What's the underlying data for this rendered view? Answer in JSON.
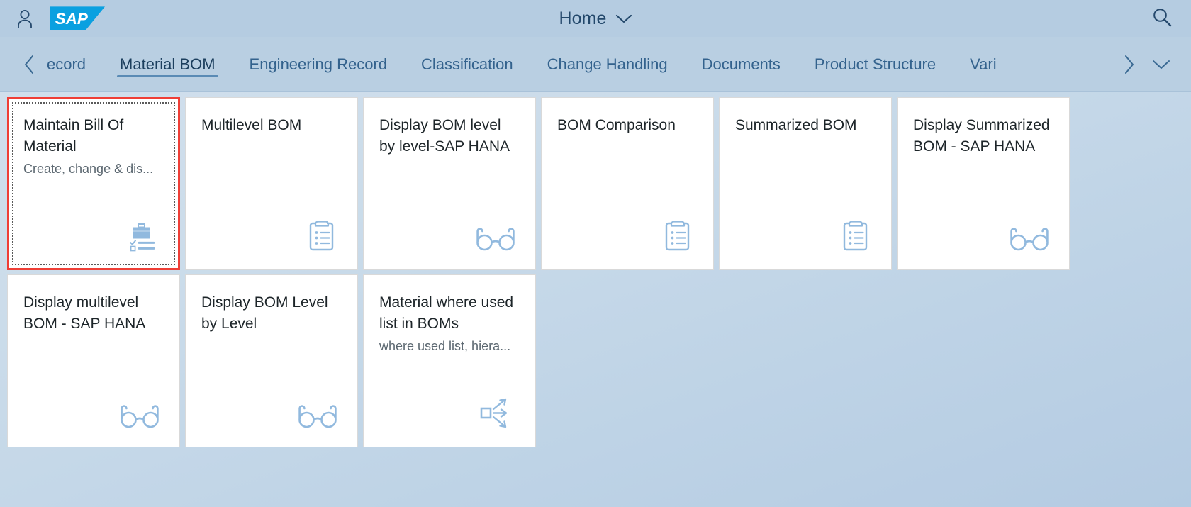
{
  "header": {
    "user_icon": "user-icon",
    "logo_text": "SAP",
    "home_label": "Home",
    "home_chevron_icon": "chevron-down-icon",
    "search_icon": "search-icon"
  },
  "tabbar": {
    "prev_icon": "chevron-left-icon",
    "next_icon": "chevron-right-icon",
    "overflow_icon": "chevron-down-icon",
    "tabs": [
      {
        "label": "ecord",
        "selected": false,
        "clipped": "left"
      },
      {
        "label": "Material BOM",
        "selected": true,
        "clipped": "none"
      },
      {
        "label": "Engineering Record",
        "selected": false,
        "clipped": "none"
      },
      {
        "label": "Classification",
        "selected": false,
        "clipped": "none"
      },
      {
        "label": "Change Handling",
        "selected": false,
        "clipped": "none"
      },
      {
        "label": "Documents",
        "selected": false,
        "clipped": "none"
      },
      {
        "label": "Product Structure",
        "selected": false,
        "clipped": "none"
      },
      {
        "label": "Vari",
        "selected": false,
        "clipped": "right"
      }
    ]
  },
  "tiles": {
    "row1": [
      {
        "title": "Maintain Bill Of Material",
        "subtitle": "Create, change & dis...",
        "icon": "briefcase-checklist-icon",
        "highlighted": true
      },
      {
        "title": "Multilevel BOM",
        "subtitle": "",
        "icon": "clipboard-list-icon",
        "highlighted": false
      },
      {
        "title": "Display BOM level by level-SAP HANA",
        "subtitle": "",
        "icon": "eyeglasses-icon",
        "highlighted": false
      },
      {
        "title": "BOM Comparison",
        "subtitle": "",
        "icon": "clipboard-list-icon",
        "highlighted": false
      },
      {
        "title": "Summarized BOM",
        "subtitle": "",
        "icon": "clipboard-list-icon",
        "highlighted": false
      },
      {
        "title": "Display Summarized BOM - SAP HANA",
        "subtitle": "",
        "icon": "eyeglasses-icon",
        "highlighted": false
      }
    ],
    "row2": [
      {
        "title": "Display multilevel BOM - SAP HANA",
        "subtitle": "",
        "icon": "eyeglasses-icon",
        "highlighted": false
      },
      {
        "title": "Display BOM Level by Level",
        "subtitle": "",
        "icon": "eyeglasses-icon",
        "highlighted": false
      },
      {
        "title": "Material where used list in BOMs",
        "subtitle": "where used list, hiera...",
        "icon": "where-used-icon",
        "highlighted": false
      }
    ]
  },
  "colors": {
    "header_bg": "#b5cce1",
    "tabbar_bg": "#b9cfe2",
    "sap_blue": "#0aa0e0",
    "tab_text": "#33628d",
    "tab_selected_text": "#1c3f5e",
    "tile_icon": "#91b9de",
    "highlight_red": "#ef3e36",
    "tile_title": "#1d2529",
    "tile_subtitle": "#5b6770"
  }
}
